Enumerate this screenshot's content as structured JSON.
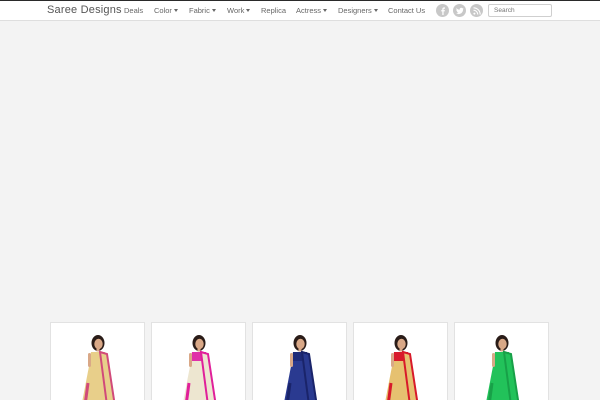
{
  "brand": "Saree Designs",
  "nav": [
    {
      "label": "Deals",
      "dropdown": false
    },
    {
      "label": "Color",
      "dropdown": true
    },
    {
      "label": "Fabric",
      "dropdown": true
    },
    {
      "label": "Work",
      "dropdown": true
    },
    {
      "label": "Replica",
      "dropdown": false
    },
    {
      "label": "Actress",
      "dropdown": true
    },
    {
      "label": "Designers",
      "dropdown": true
    },
    {
      "label": "Contact Us",
      "dropdown": false
    }
  ],
  "social": [
    "facebook-icon",
    "twitter-icon",
    "rss-icon"
  ],
  "search": {
    "placeholder": "Search"
  },
  "colors": {
    "background": "#f3f3f3",
    "navbar": "#ffffff",
    "icon": "#c8c8c8"
  },
  "products": [
    {
      "saree": "#e8cf8a",
      "border": "#d14a7a",
      "blouse": "#e8cf8a"
    },
    {
      "saree": "#ede6d0",
      "border": "#e0209a",
      "blouse": "#e030a8"
    },
    {
      "saree": "#2a3a90",
      "border": "#1a246a",
      "blouse": "#1e2a78"
    },
    {
      "saree": "#e6c170",
      "border": "#d81a2a",
      "blouse": "#d81a2a"
    },
    {
      "saree": "#22c25a",
      "border": "#18a048",
      "blouse": "#22c25a"
    }
  ]
}
